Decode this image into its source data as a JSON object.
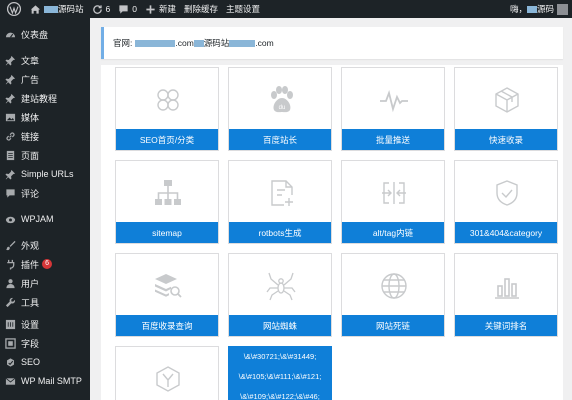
{
  "adminbar": {
    "site_name": "源码站",
    "updates_count": "6",
    "comments_count": "0",
    "new_label": "新建",
    "clear_cache_label": "删除缓存",
    "theme_settings_label": "主题设置",
    "greeting": "嗨，",
    "user_suffix": "源码"
  },
  "sidebar": {
    "items": [
      {
        "label": "仪表盘",
        "icon": "dashboard-icon"
      },
      {
        "label": "文章",
        "icon": "pin-icon"
      },
      {
        "label": "广告",
        "icon": "pin-icon"
      },
      {
        "label": "建站教程",
        "icon": "pin-icon"
      },
      {
        "label": "媒体",
        "icon": "media-icon"
      },
      {
        "label": "链接",
        "icon": "link-icon"
      },
      {
        "label": "页面",
        "icon": "page-icon"
      },
      {
        "label": "Simple URLs",
        "icon": "pin-icon"
      },
      {
        "label": "评论",
        "icon": "comment-icon"
      },
      {
        "label": "WPJAM",
        "icon": "wpjam-icon"
      },
      {
        "label": "外观",
        "icon": "brush-icon"
      },
      {
        "label": "插件",
        "icon": "plugin-icon",
        "badge": "6"
      },
      {
        "label": "用户",
        "icon": "user-icon"
      },
      {
        "label": "工具",
        "icon": "wrench-icon"
      },
      {
        "label": "设置",
        "icon": "settings-icon"
      },
      {
        "label": "字段",
        "icon": "field-icon"
      },
      {
        "label": "SEO",
        "icon": "seo-icon"
      },
      {
        "label": "WP Mail SMTP",
        "icon": "mail-icon"
      }
    ]
  },
  "notice": {
    "prefix": "官网: ",
    "part1": ".com",
    "part2": "源码站",
    "part3": ".com"
  },
  "cards": [
    {
      "label": "SEO首页/分类",
      "icon": "clover-icon"
    },
    {
      "label": "百度站长",
      "icon": "baidu-paw-icon"
    },
    {
      "label": "批量推送",
      "icon": "pulse-icon"
    },
    {
      "label": "快速收录",
      "icon": "box-icon"
    },
    {
      "label": "sitemap",
      "icon": "sitemap-icon"
    },
    {
      "label": "rotbots生成",
      "icon": "file-add-icon"
    },
    {
      "label": "alt/tag内链",
      "icon": "split-icon"
    },
    {
      "label": "301&404&category",
      "icon": "shield-check-icon"
    },
    {
      "label": "百度收录查询",
      "icon": "stack-search-icon"
    },
    {
      "label": "网站蜘蛛",
      "icon": "spider-icon"
    },
    {
      "label": "网站死链",
      "icon": "globe-icon"
    },
    {
      "label": "关键词排名",
      "icon": "bar-chart-icon"
    },
    {
      "label": "",
      "icon": "hexagon-y-icon"
    }
  ],
  "code_card": {
    "lines": [
      "\\&\\#30721;\\&\\#31449;",
      "\\&\\#105;\\&\\#111;\\&\\#121;",
      "\\&\\#109;\\&\\#122;\\&\\#46;"
    ]
  },
  "colors": {
    "adminbar_bg": "#1d2327",
    "accent_blue": "#0f7fd8",
    "notice_border": "#72aee6",
    "badge_red": "#d63638"
  }
}
